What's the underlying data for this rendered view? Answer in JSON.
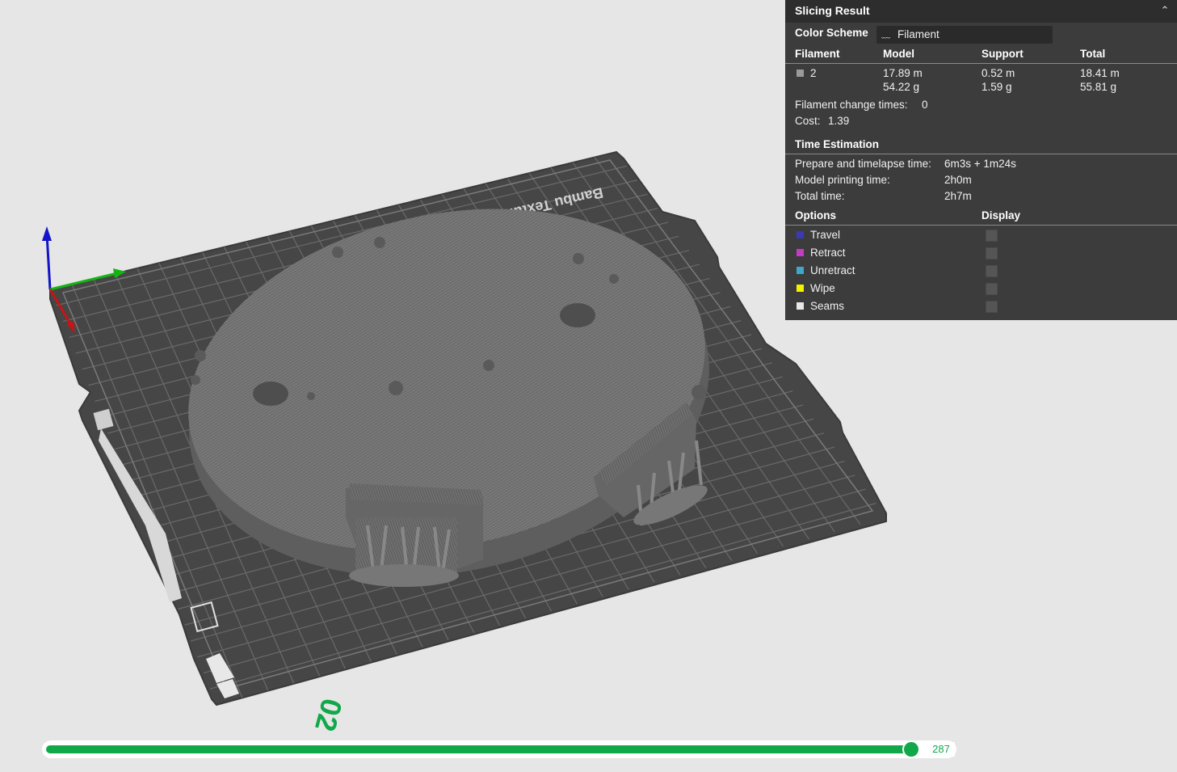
{
  "viewport": {
    "plate_label": "Bambu Textured PEI",
    "plate_number": "02"
  },
  "panel": {
    "title": "Slicing Result",
    "color_scheme": {
      "label": "Color Scheme",
      "value": "Filament"
    },
    "filament_table": {
      "headers": [
        "Filament",
        "Model",
        "Support",
        "Total"
      ],
      "rows": [
        {
          "filament": "2",
          "swatch_color": "#9a9a9a",
          "model_length": "17.89 m",
          "model_weight": "54.22 g",
          "support_length": "0.52 m",
          "support_weight": "1.59 g",
          "total_length": "18.41 m",
          "total_weight": "55.81 g"
        }
      ]
    },
    "filament_change": {
      "label": "Filament change times:",
      "value": "0"
    },
    "cost": {
      "label": "Cost:",
      "value": "1.39"
    },
    "time_estimation": {
      "heading": "Time Estimation",
      "prepare": {
        "label": "Prepare and timelapse time:",
        "value": "6m3s + 1m24s"
      },
      "model": {
        "label": "Model printing time:",
        "value": "2h0m"
      },
      "total": {
        "label": "Total time:",
        "value": "2h7m"
      }
    },
    "options": {
      "heading": "Options",
      "display_heading": "Display",
      "items": [
        {
          "label": "Travel",
          "color": "#3a3ab8",
          "checked": false
        },
        {
          "label": "Retract",
          "color": "#c43cc4",
          "checked": false
        },
        {
          "label": "Unretract",
          "color": "#3fa7c9",
          "checked": false
        },
        {
          "label": "Wipe",
          "color": "#f2f200",
          "checked": false
        },
        {
          "label": "Seams",
          "color": "#e8e8e8",
          "checked": false
        }
      ]
    }
  },
  "slider": {
    "value": "287",
    "fraction": 1.0
  }
}
